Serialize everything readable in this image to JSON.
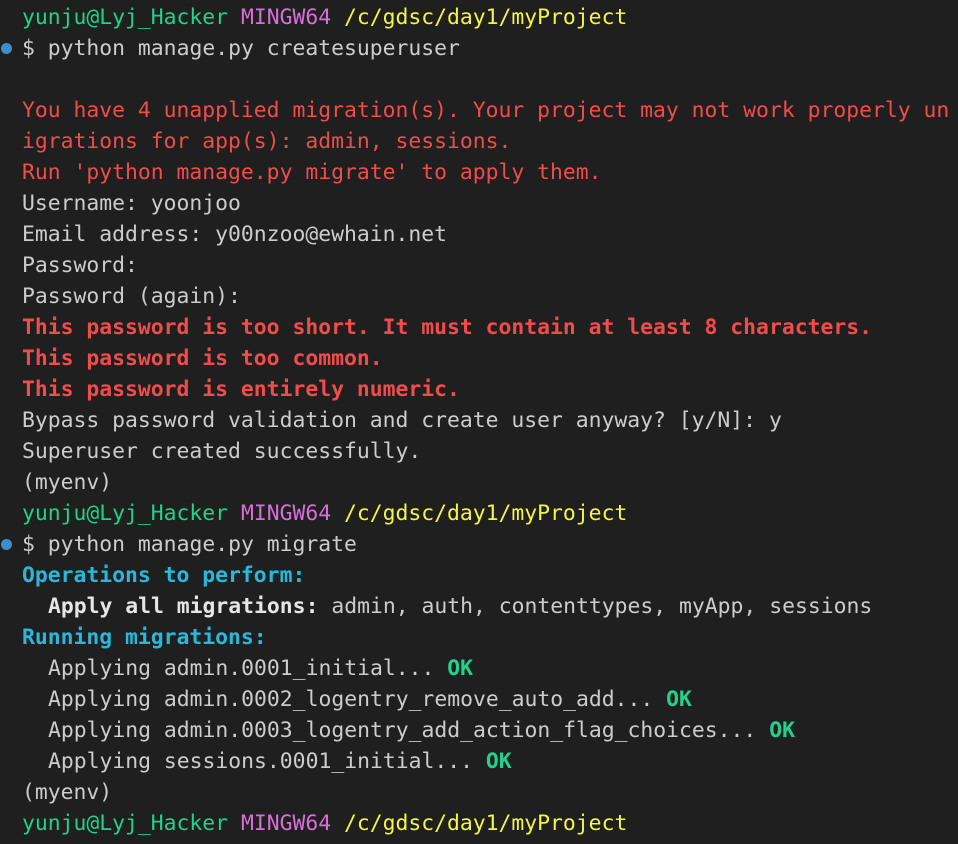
{
  "prompt": {
    "user": "yunju@Lyj_Hacker",
    "host": "MINGW64",
    "path": "/c/gdsc/day1/myProject",
    "symbol": "$",
    "env": "(myenv)"
  },
  "commands": {
    "first": "python manage.py createsuperuser",
    "second": "python manage.py migrate"
  },
  "warning": {
    "line1": "You have 4 unapplied migration(s). Your project may not work properly un",
    "line2": "igrations for app(s): admin, sessions.",
    "line3": "Run 'python manage.py migrate' to apply them."
  },
  "createsuperuser": {
    "username": "Username: yoonjoo",
    "email": "Email address: y00nzoo@ewhain.net",
    "password": "Password:",
    "password_again": "Password (again):",
    "errors": [
      "This password is too short. It must contain at least 8 characters.",
      "This password is too common.",
      "This password is entirely numeric."
    ],
    "bypass": "Bypass password validation and create user anyway? [y/N]: y",
    "success": "Superuser created successfully."
  },
  "migrate": {
    "operations_heading": "Operations to perform:",
    "apply_label": "Apply all migrations:",
    "apply_apps": " admin, auth, contenttypes, myApp, sessions",
    "running_heading": "Running migrations:",
    "steps": [
      {
        "text": "Applying admin.0001_initial...",
        "status": "OK"
      },
      {
        "text": "Applying admin.0002_logentry_remove_auto_add...",
        "status": "OK"
      },
      {
        "text": "Applying admin.0003_logentry_add_action_flag_choices...",
        "status": "OK"
      },
      {
        "text": "Applying sessions.0001_initial...",
        "status": "OK"
      }
    ]
  },
  "colors": {
    "background": "#1f1f1f",
    "user": "#23d18b",
    "host": "#d670d6",
    "path": "#f5f543",
    "error": "#f14c4c",
    "heading": "#29b8db",
    "decoration_dot": "#3c8ecb"
  }
}
